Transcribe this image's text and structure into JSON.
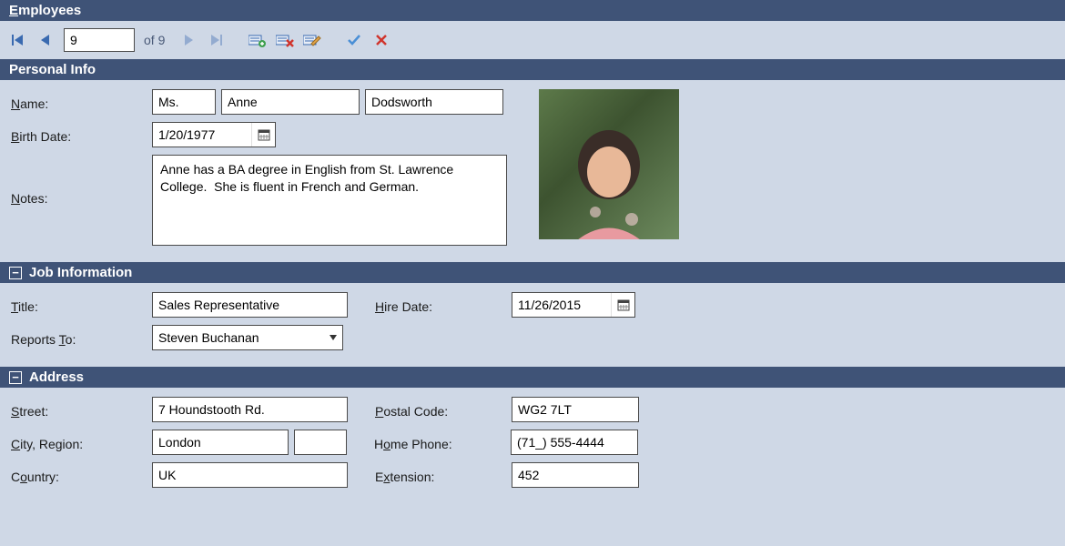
{
  "titlebar": {
    "text": "Employees",
    "mnemonic": "E"
  },
  "navigator": {
    "current": "9",
    "total_label": "of 9"
  },
  "sections": {
    "personal": {
      "title": "Personal Info"
    },
    "job": {
      "title": "Job Information"
    },
    "address": {
      "title": "Address"
    }
  },
  "labels": {
    "name": "Name:",
    "birth_date": "Birth Date:",
    "notes": "Notes:",
    "title": "Title:",
    "hire_date": "Hire Date:",
    "reports_to": "Reports To:",
    "street": "Street:",
    "city_region": "City, Region:",
    "country": "Country:",
    "postal_code": "Postal Code:",
    "home_phone": "Home Phone:",
    "extension": "Extension:"
  },
  "values": {
    "title_of_courtesy": "Ms.",
    "first_name": "Anne",
    "last_name": "Dodsworth",
    "birth_date": "1/20/1977",
    "notes": "Anne has a BA degree in English from St. Lawrence College.  She is fluent in French and German.",
    "job_title": "Sales Representative",
    "hire_date": "11/26/2015",
    "reports_to": "Steven Buchanan",
    "street": "7 Houndstooth Rd.",
    "city": "London",
    "region": "",
    "country": "UK",
    "postal_code": "WG2 7LT",
    "home_phone": "(71_) 555-4444",
    "extension": "452"
  },
  "icons": {
    "first": "⏮",
    "prev": "◀",
    "next": "▶",
    "last": "⏭",
    "add": "add-record",
    "delete": "delete-record",
    "edit": "edit-record",
    "end_edit": "✔",
    "cancel": "✖",
    "calendar": "📅",
    "dropdown": "▾",
    "collapse": "−"
  }
}
